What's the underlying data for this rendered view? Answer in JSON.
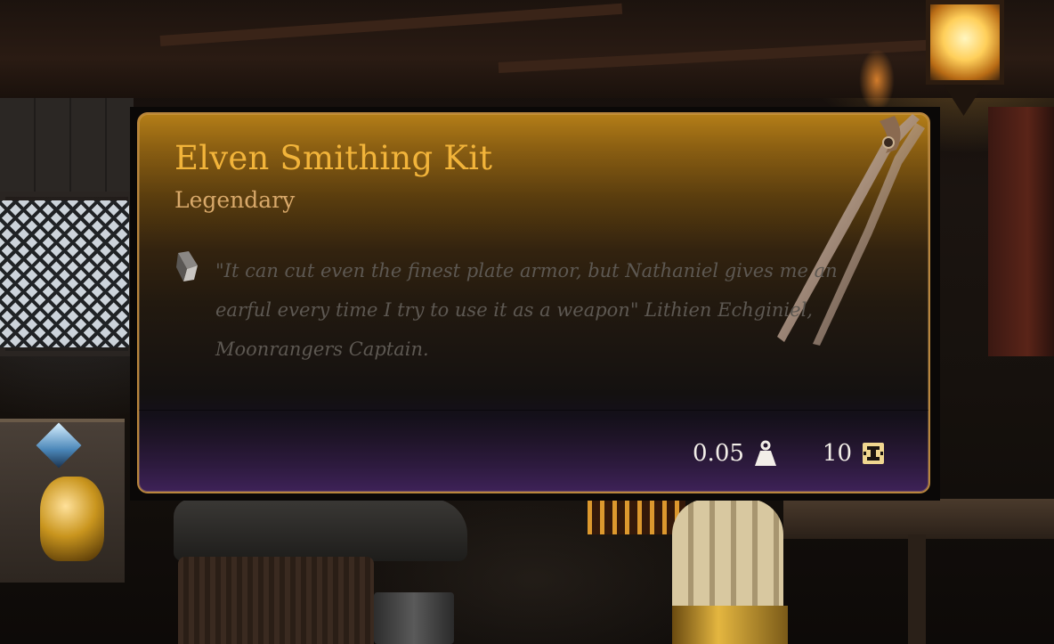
{
  "tooltip": {
    "title": "Elven Smithing Kit",
    "rarity": "Legendary",
    "description": "\"It can cut even the finest plate armor, but Nathaniel gives me an earful every time I try to use it as a weapon\" Lithien Echginiel, Moonrangers Captain.",
    "weight": "0.05",
    "value": "10",
    "icons": {
      "description": "flavor-text-icon",
      "weight": "weight-icon",
      "value": "gold-coin-icon",
      "art": "tongs-item-icon"
    },
    "colors": {
      "title": "#f2b43a",
      "rarity": "#d9a96a",
      "description": "#5d5852",
      "border": "#b8853d",
      "stats": "#f2eee8"
    }
  }
}
